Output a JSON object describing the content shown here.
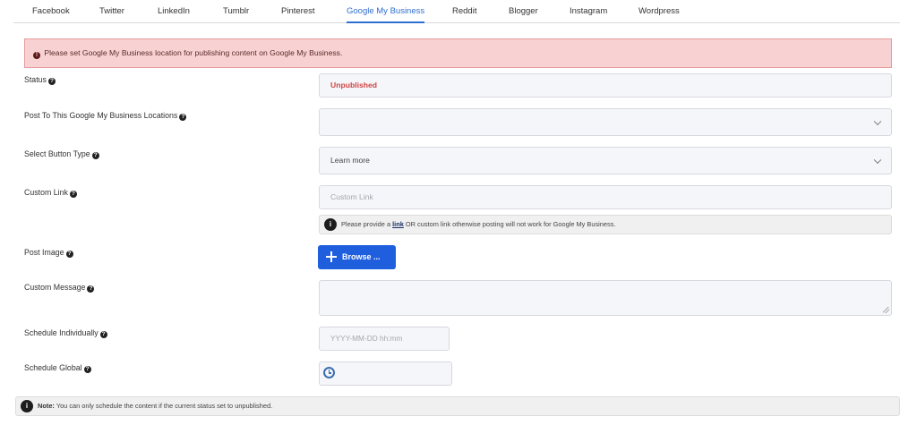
{
  "tabs": [
    {
      "label": "Facebook"
    },
    {
      "label": "Twitter"
    },
    {
      "label": "LinkedIn"
    },
    {
      "label": "Tumblr"
    },
    {
      "label": "Pinterest"
    },
    {
      "label": "Google My Business",
      "active": true
    },
    {
      "label": "Reddit"
    },
    {
      "label": "Blogger"
    },
    {
      "label": "Instagram"
    },
    {
      "label": "Wordpress"
    }
  ],
  "alert": {
    "icon": "!",
    "text": "Please set Google My Business location for publishing content on Google My Business."
  },
  "help_glyph": "?",
  "form": {
    "status": {
      "label": "Status",
      "value": "Unpublished"
    },
    "locations": {
      "label": "Post To This Google My Business Locations",
      "value": ""
    },
    "button_type": {
      "label": "Select Button Type",
      "value": "Learn more"
    },
    "custom_link": {
      "label": "Custom Link",
      "placeholder": "Custom Link",
      "info_icon": "i",
      "info_before": "Please provide a",
      "info_link": "link",
      "info_after": "OR custom link otherwise posting will not work for Google My Business."
    },
    "post_image": {
      "label": "Post Image",
      "button": "Browse ..."
    },
    "custom_message": {
      "label": "Custom Message"
    },
    "schedule_individually": {
      "label": "Schedule Individually",
      "placeholder": "YYYY-MM-DD hh:mm"
    },
    "schedule_global": {
      "label": "Schedule Global"
    }
  },
  "note": {
    "icon": "i",
    "bold": "Note:",
    "text": "You can only schedule the content if the current status set to unpublished."
  },
  "colors": {
    "accent": "#1f5fde",
    "active_tab": "#2f6fd0",
    "alert_bg": "#f8d2d2",
    "status_red": "#d24545"
  },
  "icons": [
    "exclamation-circle-icon",
    "question-circle-icon",
    "chevron-down-icon",
    "info-circle-icon",
    "plus-icon",
    "clock-icon",
    "resize-grip-icon"
  ]
}
